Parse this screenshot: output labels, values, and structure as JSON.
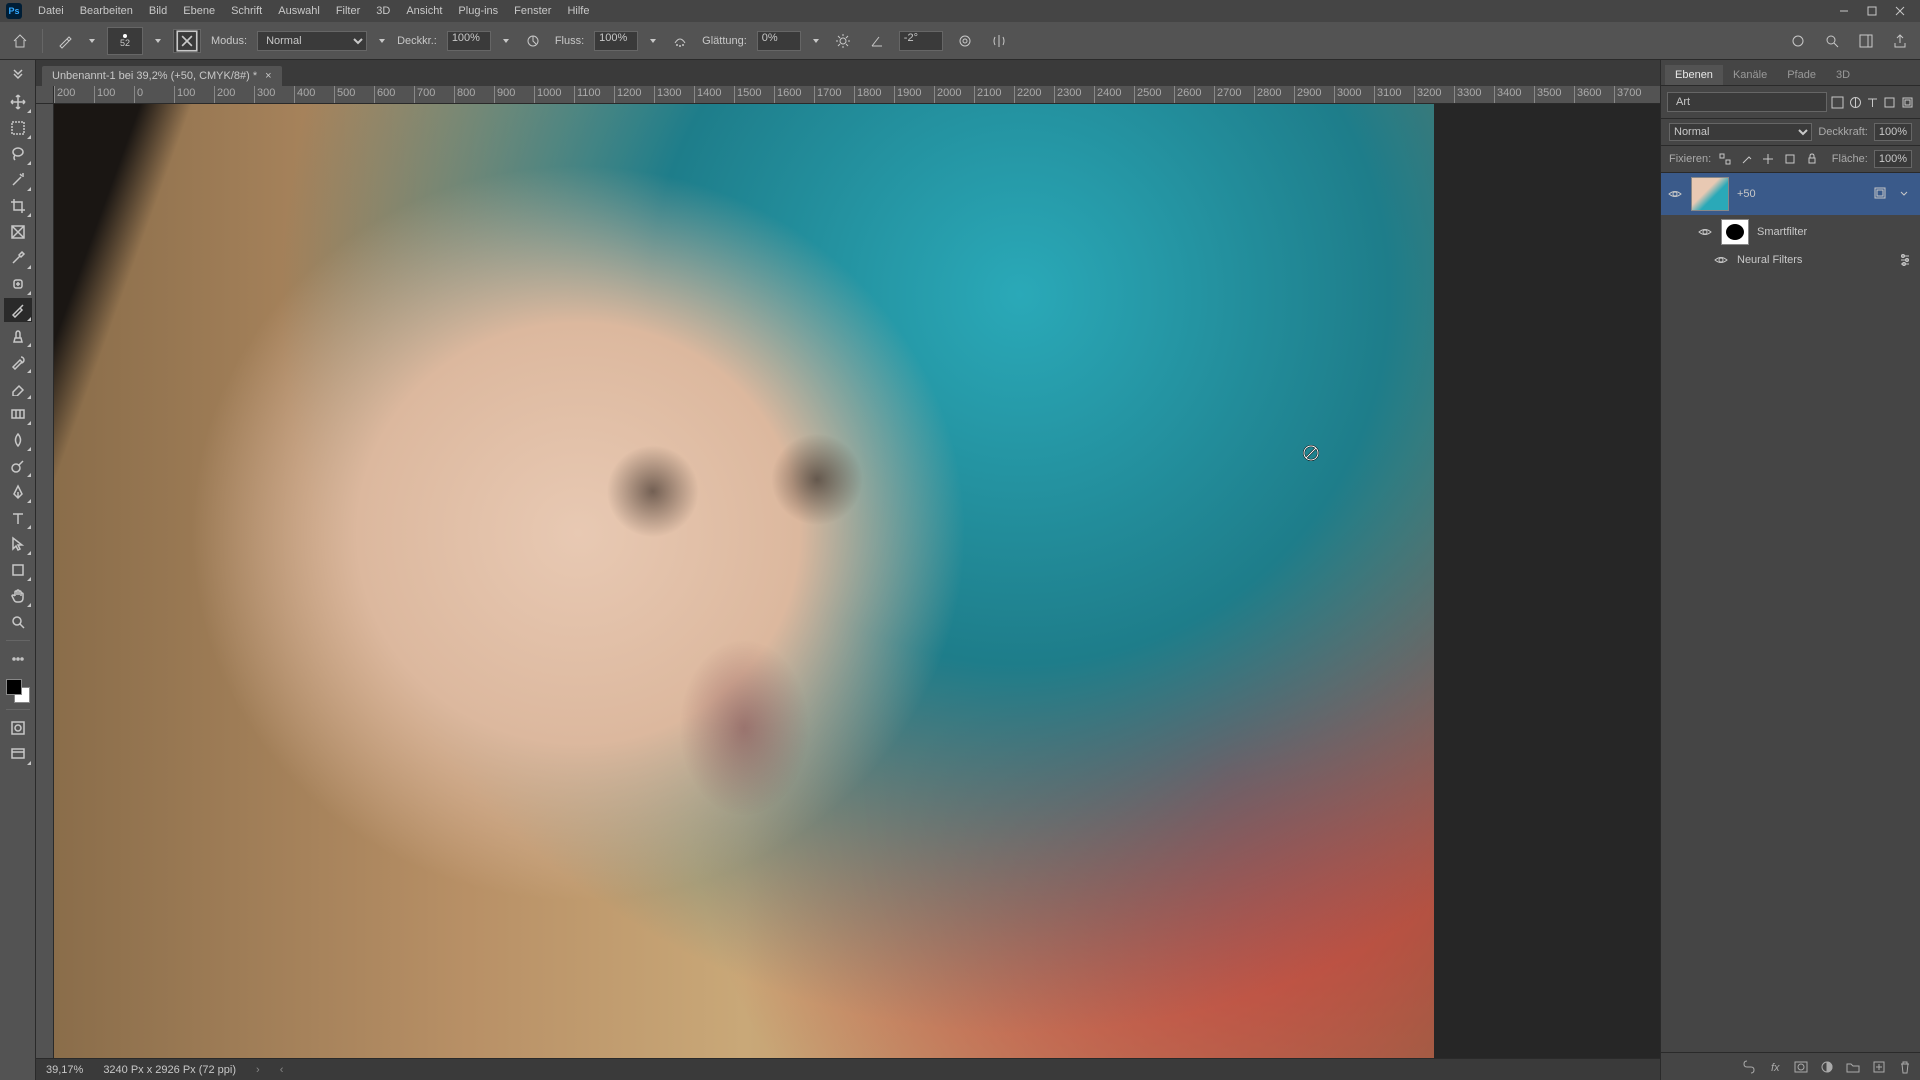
{
  "app": {
    "logo": "Ps"
  },
  "menu": {
    "items": [
      "Datei",
      "Bearbeiten",
      "Bild",
      "Ebene",
      "Schrift",
      "Auswahl",
      "Filter",
      "3D",
      "Ansicht",
      "Plug-ins",
      "Fenster",
      "Hilfe"
    ]
  },
  "options": {
    "brush_size": "52",
    "mode_label": "Modus:",
    "mode_value": "Normal",
    "opacity_label": "Deckkr.:",
    "opacity_value": "100%",
    "flow_label": "Fluss:",
    "flow_value": "100%",
    "smoothing_label": "Glättung:",
    "smoothing_value": "0%",
    "angle_value": "-2°"
  },
  "document": {
    "tab_title": "Unbenannt-1 bei 39,2% (+50, CMYK/8#) *",
    "ruler_ticks": [
      "200",
      "100",
      "0",
      "100",
      "200",
      "300",
      "400",
      "500",
      "600",
      "700",
      "800",
      "900",
      "1000",
      "1100",
      "1200",
      "1300",
      "1400",
      "1500",
      "1600",
      "1700",
      "1800",
      "1900",
      "2000",
      "2100",
      "2200",
      "2300",
      "2400",
      "2500",
      "2600",
      "2700",
      "2800",
      "2900",
      "3000",
      "3100",
      "3200",
      "3300",
      "3400",
      "3500",
      "3600",
      "3700"
    ]
  },
  "status": {
    "zoom": "39,17%",
    "dims": "3240 Px x 2926 Px (72 ppi)"
  },
  "panels": {
    "tabs": [
      "Ebenen",
      "Kanäle",
      "Pfade",
      "3D"
    ],
    "search_value": "Art",
    "blend_mode": "Normal",
    "opacity_label": "Deckkraft:",
    "opacity_value": "100%",
    "lock_label": "Fixieren:",
    "fill_label": "Fläche:",
    "fill_value": "100%",
    "layer1_name": "+50",
    "layer2_name": "Smartfilter",
    "layer3_name": "Neural Filters"
  }
}
